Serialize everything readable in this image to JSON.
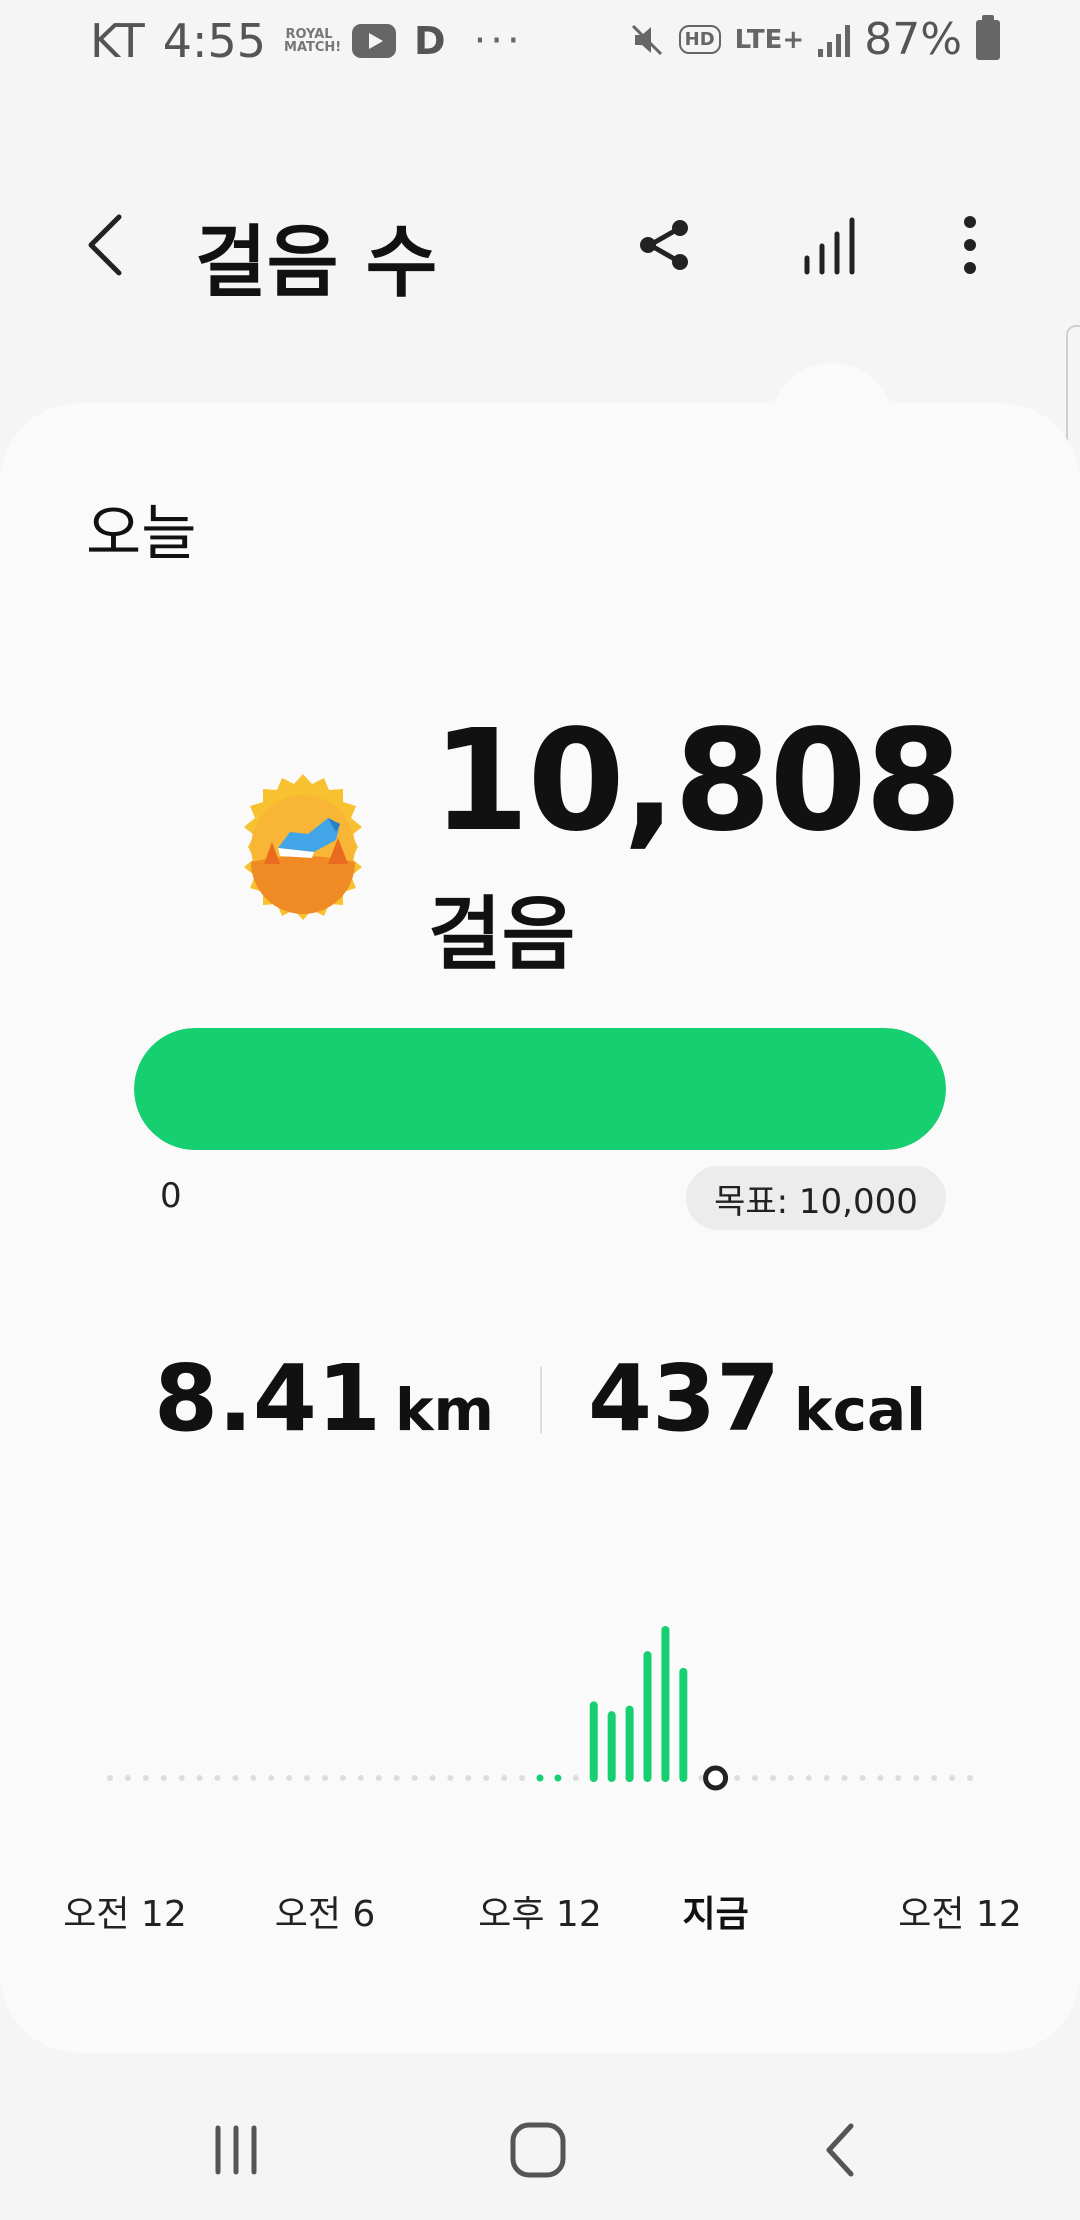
{
  "status_bar": {
    "carrier": "KT",
    "time": "4:55",
    "royal_match_icon": "ROYAL MATCH!",
    "youtube_icon": "youtube-icon",
    "d_icon": "D",
    "more_notifications": "···",
    "hd_badge": "HD",
    "network": "LTE+",
    "battery": "87%"
  },
  "header": {
    "title": "걸음 수",
    "back_icon": "back-icon",
    "share_icon": "share-icon",
    "trends_icon": "trends-icon",
    "more_icon": "more-vert-icon"
  },
  "card": {
    "day_label": "오늘",
    "steps": "10,808",
    "steps_unit": "걸음",
    "progress_fraction": 1.0,
    "progress_min": "0",
    "goal_label": "목표: 10,000",
    "distance_value": "8.41",
    "distance_unit": "km",
    "calories_value": "437",
    "calories_unit": "kcal"
  },
  "colors": {
    "accent": "#16cf70",
    "dot": "#dddddd",
    "card_bg": "#fafafa",
    "page_bg": "#f5f5f5"
  },
  "chart_data": {
    "type": "bar",
    "x_labels": [
      "오전 12",
      "오전 6",
      "오후 12",
      "지금",
      "오전 12"
    ],
    "x_label_hours": [
      0,
      6,
      12,
      16.9,
      24
    ],
    "current_hour": 16.9,
    "x_range": [
      0,
      24
    ],
    "slots_per_hour": 2,
    "bar_slots": [
      24,
      25,
      27,
      28,
      29,
      30,
      31,
      32
    ],
    "bar_values": [
      2,
      2,
      520,
      450,
      490,
      880,
      1060,
      760
    ],
    "y_max": 1060,
    "grid": false
  },
  "nav_bar": {
    "recents_icon": "recents-icon",
    "home_icon": "home-icon",
    "back_icon": "nav-back-icon"
  }
}
